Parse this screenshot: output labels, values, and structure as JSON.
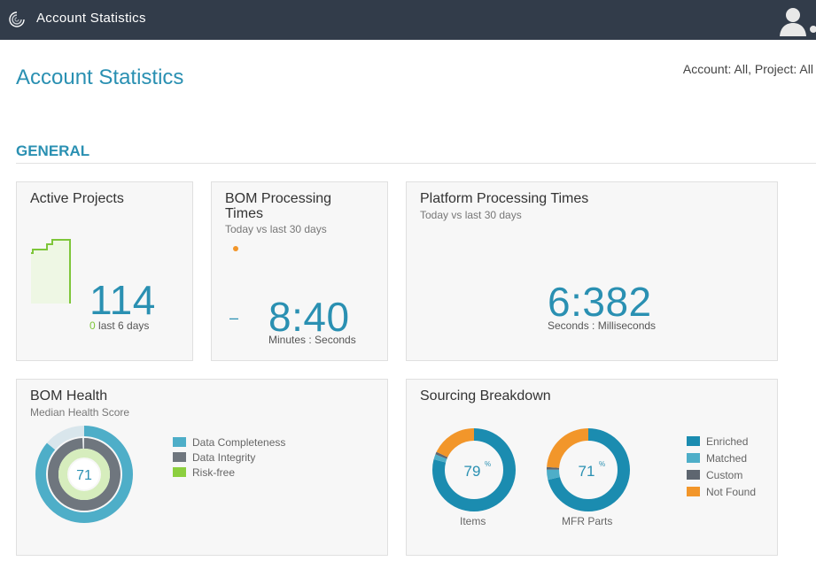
{
  "header": {
    "app_title": "Account Statistics"
  },
  "page": {
    "title": "Account Statistics",
    "scope": "Account: All, Project: All",
    "section": "GENERAL"
  },
  "active_projects": {
    "title": "Active Projects",
    "value": "114",
    "change": "0",
    "change_label": "last 6 days"
  },
  "bom_processing": {
    "title": "BOM Processing Times",
    "subtitle": "Today vs last 30 days",
    "trend": "–",
    "value": "8:40",
    "unit": "Minutes : Seconds"
  },
  "platform_processing": {
    "title": "Platform Processing Times",
    "subtitle": "Today vs last 30 days",
    "value": "6:382",
    "unit": "Seconds : Milliseconds"
  },
  "bom_health": {
    "title": "BOM Health",
    "subtitle": "Median Health Score",
    "score": "71",
    "legend": [
      "Data Completeness",
      "Data Integrity",
      "Risk-free"
    ],
    "rings": [
      {
        "name": "Data Completeness",
        "value": 0.86
      },
      {
        "name": "Data Integrity",
        "value": 0.99
      },
      {
        "name": "Risk-free",
        "value": 1.0
      }
    ]
  },
  "sourcing": {
    "title": "Sourcing Breakdown",
    "legend": [
      "Enriched",
      "Matched",
      "Custom",
      "Not Found"
    ],
    "donuts": [
      {
        "label": "Items",
        "percent": "79",
        "segments": [
          0.79,
          0.02,
          0.01,
          0.18
        ]
      },
      {
        "label": "MFR Parts",
        "percent": "71",
        "segments": [
          0.71,
          0.04,
          0.01,
          0.24
        ]
      }
    ]
  },
  "colors": {
    "accent": "#2a90b2",
    "enriched": "#1b8cb0",
    "matched": "#4eaec8",
    "custom": "#5e6670",
    "not_found": "#f2962a",
    "risk_free": "#8ccf3f",
    "trend_dot": "#f2962a"
  }
}
